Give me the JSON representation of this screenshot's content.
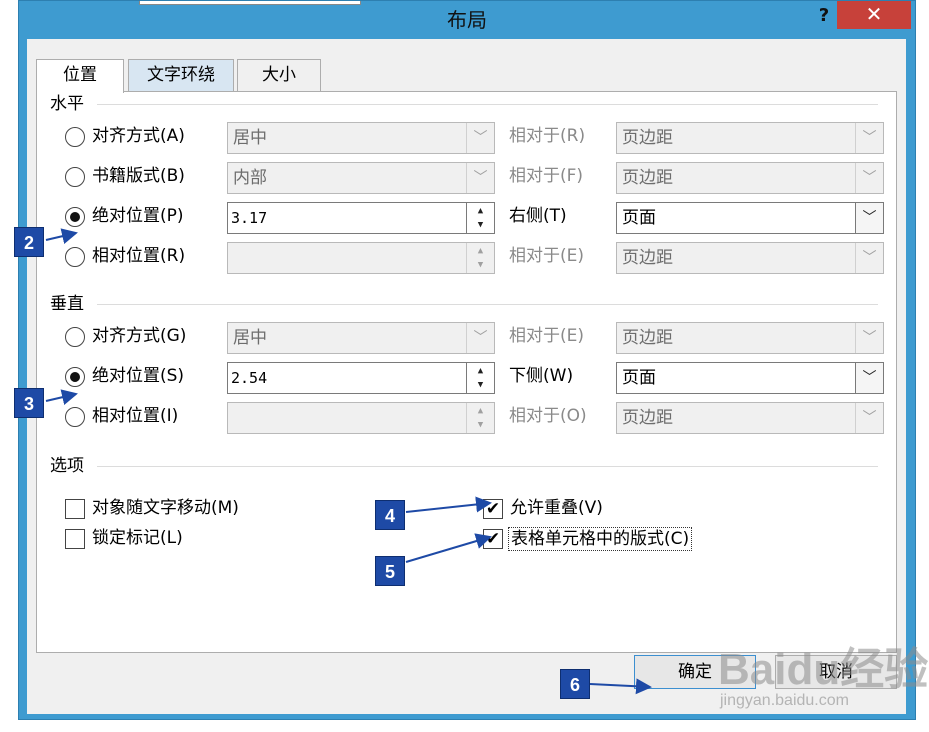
{
  "window": {
    "title": "布局",
    "help": "?",
    "close": "✕"
  },
  "tabs": [
    {
      "label": "位置"
    },
    {
      "label": "文字环绕"
    },
    {
      "label": "大小"
    }
  ],
  "horizontal": {
    "heading": "水平",
    "rows": [
      {
        "label": "对齐方式(A)",
        "value": "居中",
        "relative_label": "相对于(R)",
        "relative_value": "页边距"
      },
      {
        "label": "书籍版式(B)",
        "value": "内部",
        "relative_label": "相对于(F)",
        "relative_value": "页边距"
      },
      {
        "label": "绝对位置(P)",
        "value": "3.17",
        "relative_label": "右侧(T)",
        "relative_value": "页面"
      },
      {
        "label": "相对位置(R)",
        "value": "",
        "relative_label": "相对于(E)",
        "relative_value": "页边距"
      }
    ]
  },
  "vertical": {
    "heading": "垂直",
    "rows": [
      {
        "label": "对齐方式(G)",
        "value": "居中",
        "relative_label": "相对于(E)",
        "relative_value": "页边距"
      },
      {
        "label": "绝对位置(S)",
        "value": "2.54",
        "relative_label": "下侧(W)",
        "relative_value": "页面"
      },
      {
        "label": "相对位置(I)",
        "value": "",
        "relative_label": "相对于(O)",
        "relative_value": "页边距"
      }
    ]
  },
  "options": {
    "heading": "选项",
    "move_with_text": "对象随文字移动(M)",
    "lock_anchor": "锁定标记(L)",
    "allow_overlap": "允许重叠(V)",
    "layout_in_cell": "表格单元格中的版式(C)"
  },
  "buttons": {
    "ok": "确定",
    "cancel": "取消"
  },
  "markers": [
    "2",
    "3",
    "4",
    "5",
    "6"
  ],
  "watermark": {
    "brand": "Baidu经验",
    "url": "jingyan.baidu.com"
  }
}
